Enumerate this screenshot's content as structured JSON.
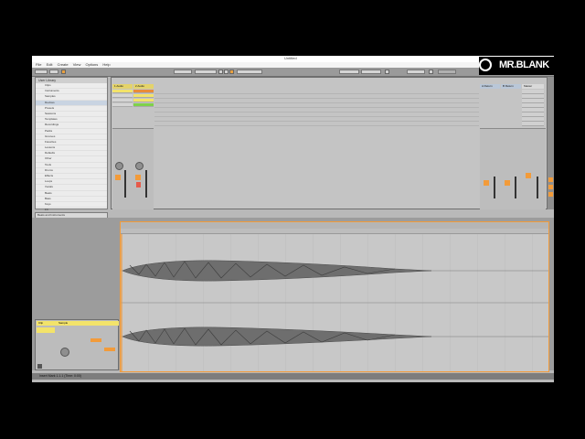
{
  "window": {
    "title": "Untitled"
  },
  "menu": [
    "File",
    "Edit",
    "Create",
    "View",
    "Options",
    "Help"
  ],
  "browser": {
    "header": "User Library",
    "items": [
      "Clips",
      "Instruments",
      "Samples",
      "Devices",
      "Presets",
      "Sessions",
      "Templates",
      "Recordings",
      "Packs",
      "Grooves",
      "Favorites",
      "Lessons",
      "Defaults",
      "Other",
      "Tools",
      "Drums",
      "Effects",
      "Loops",
      "Vocals",
      "Beats",
      "Bass",
      "Keys",
      "FX"
    ]
  },
  "info": {
    "title": "Beats and Instruments",
    "columns": [
      "Name",
      "Size",
      "Date"
    ],
    "hint": "Drop Files or Devices Here"
  },
  "session": {
    "tracks": [
      "1 Audio",
      "2 Audio"
    ],
    "returns": [
      "A Return",
      "B Return",
      "Master"
    ],
    "scenes": [
      "1",
      "2",
      "3",
      "4",
      "5",
      "6",
      "7",
      "8"
    ],
    "drop_text": "Drop Files and Devices Here"
  },
  "clip_view": {
    "clip_tab": "Clip",
    "sample_tab": "Sample",
    "clip_name": "Audio"
  },
  "status": {
    "left": "Insert Mark 1.1.1 (Time: 0:00)"
  },
  "logo": {
    "text": "MR.BLANK"
  },
  "colors": {
    "accent": "#f29b3a",
    "clip_yellow": "#f3e36a",
    "active_green": "#7fd14a"
  }
}
